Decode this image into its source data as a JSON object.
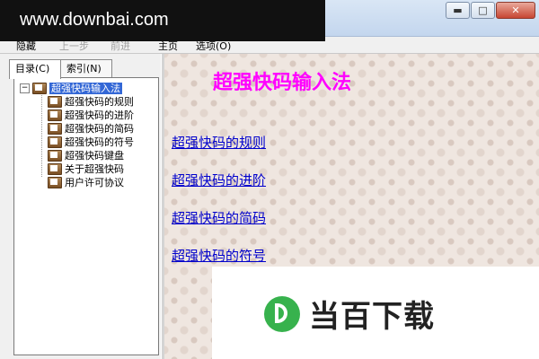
{
  "watermark": {
    "text": "www.downbai.com"
  },
  "window": {
    "controls": {
      "minimize_glyph": "▬",
      "maximize_glyph": "□",
      "close_glyph": "✕"
    }
  },
  "toolbar": {
    "hide_label": "隐藏",
    "back_label": "上一步",
    "forward_label": "前进",
    "home_label": "主页",
    "options_label": "选项(O)"
  },
  "sidebar": {
    "tabs": [
      {
        "label": "目录(C)"
      },
      {
        "label": "索引(N)"
      }
    ],
    "tree": {
      "root": "超强快码输入法",
      "expander": "−",
      "children": [
        {
          "label": "超强快码的规则"
        },
        {
          "label": "超强快码的进阶"
        },
        {
          "label": "超强快码的简码"
        },
        {
          "label": "超强快码的符号"
        },
        {
          "label": "超强快码键盘"
        },
        {
          "label": "关于超强快码"
        },
        {
          "label": "用户许可协议"
        }
      ]
    }
  },
  "content": {
    "title": "超强快码输入法",
    "links": [
      {
        "label": "超强快码的规则"
      },
      {
        "label": "超强快码的进阶"
      },
      {
        "label": "超强快码的简码"
      },
      {
        "label": "超强快码的符号"
      }
    ]
  },
  "overlay": {
    "text": "当百下载",
    "colors": {
      "logo_green": "#37b24d"
    }
  },
  "colors": {
    "title_magenta": "#ff00ff",
    "link_blue": "#0000cc",
    "selection": "#3367d6"
  }
}
